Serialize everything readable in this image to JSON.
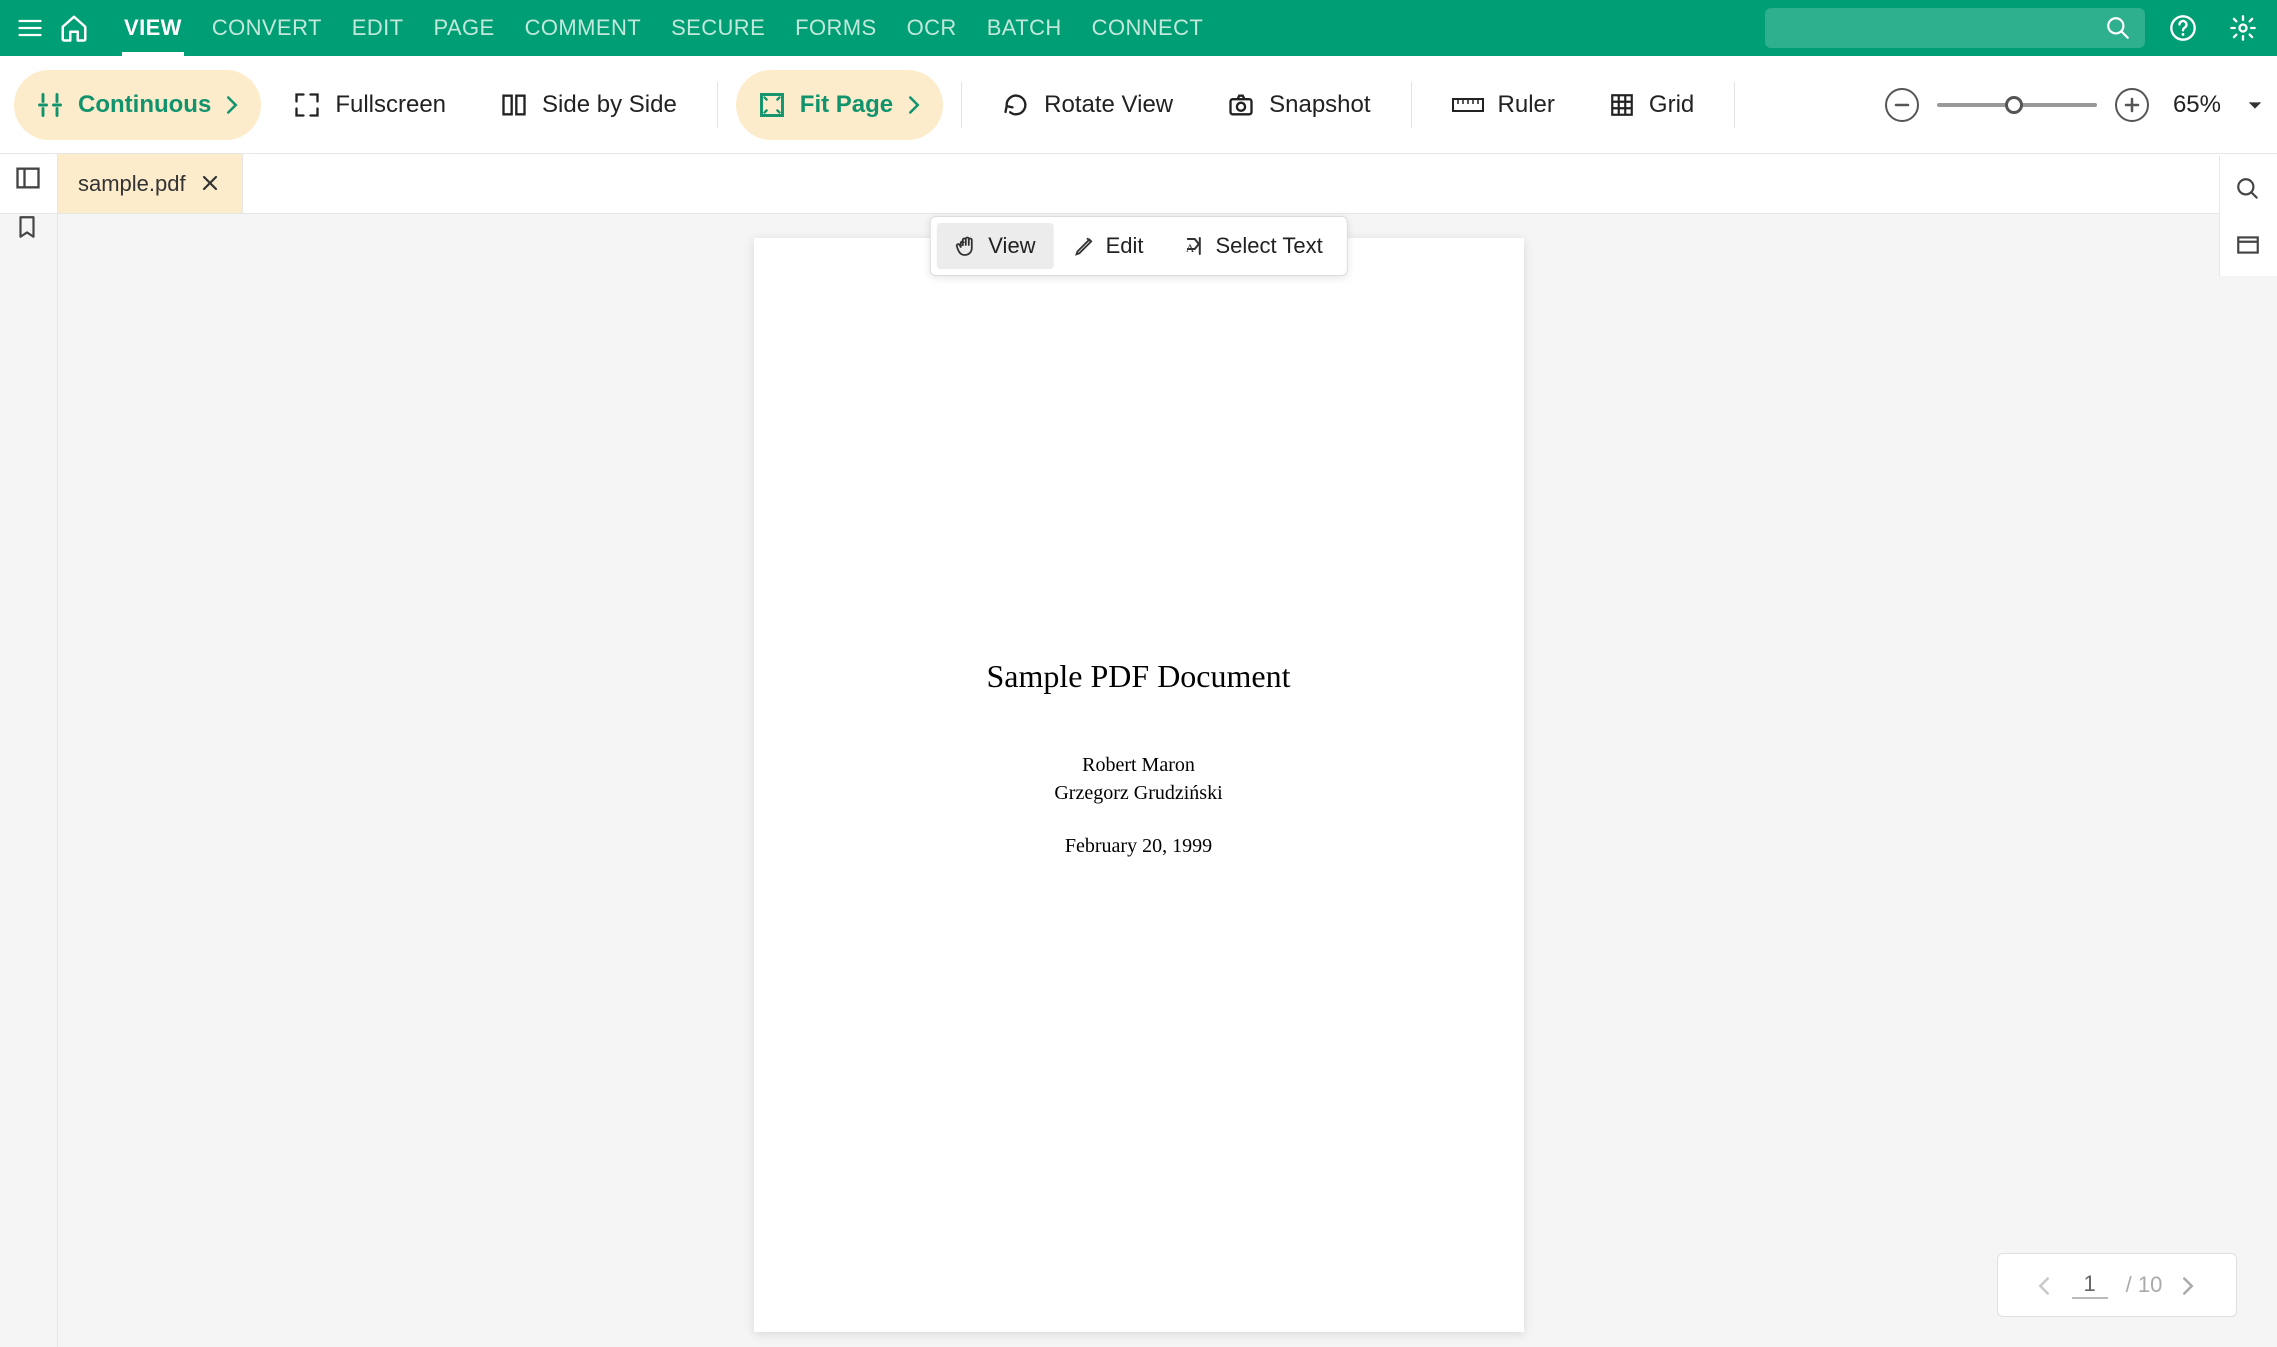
{
  "topbar": {
    "tabs": [
      "VIEW",
      "CONVERT",
      "EDIT",
      "PAGE",
      "COMMENT",
      "SECURE",
      "FORMS",
      "OCR",
      "BATCH",
      "CONNECT"
    ],
    "active_index": 0
  },
  "ribbon": {
    "continuous": "Continuous",
    "fullscreen": "Fullscreen",
    "sidebyside": "Side by Side",
    "fitpage": "Fit Page",
    "rotateview": "Rotate View",
    "snapshot": "Snapshot",
    "ruler": "Ruler",
    "grid": "Grid"
  },
  "zoom": {
    "label": "65%"
  },
  "doctab": {
    "filename": "sample.pdf"
  },
  "mode": {
    "view": "View",
    "edit": "Edit",
    "selecttext": "Select Text"
  },
  "document": {
    "title": "Sample PDF Document",
    "author1": "Robert Maron",
    "author2": "Grzegorz Grudziński",
    "date": "February 20, 1999"
  },
  "pagenav": {
    "current": "1",
    "total": "/ 10"
  }
}
